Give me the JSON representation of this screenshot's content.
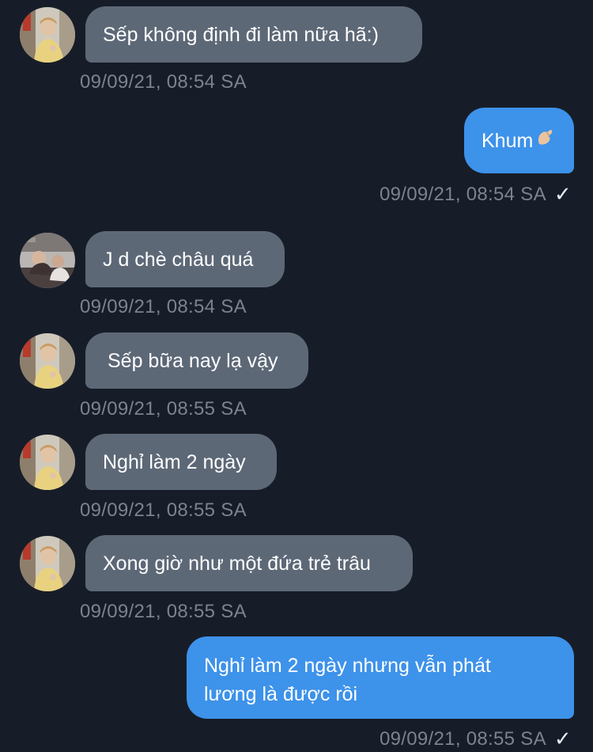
{
  "messages": [
    {
      "direction": "in",
      "sender_avatar": "avatar-boss",
      "text": "Sếp không định đi làm nữa hã:)",
      "time": "09/09/21, 08:54 SA"
    },
    {
      "direction": "out",
      "text": "Khum",
      "emoji": "pinching-hand-emoji",
      "time": "09/09/21, 08:54 SA",
      "status_icon": "read-check-icon",
      "status_glyph": "✓"
    },
    {
      "direction": "in",
      "sender_avatar": "avatar-friend",
      "text": "J d chè châu quá",
      "time": "09/09/21, 08:54 SA"
    },
    {
      "direction": "in",
      "sender_avatar": "avatar-boss",
      "text": "Sếp bữa nay lạ vậy",
      "time": "09/09/21, 08:55 SA"
    },
    {
      "direction": "in",
      "sender_avatar": "avatar-boss",
      "text": "Nghỉ làm 2 ngày",
      "time": "09/09/21, 08:55 SA"
    },
    {
      "direction": "in",
      "sender_avatar": "avatar-boss",
      "text": "Xong giờ như một đứa trẻ trâu",
      "time": "09/09/21, 08:55 SA"
    },
    {
      "direction": "out",
      "text_line1": "Nghỉ làm 2 ngày nhưng vẫn phát",
      "text_line2": "lương là được rồi",
      "time": "09/09/21, 08:55 SA",
      "status_icon": "read-check-icon",
      "status_glyph": "✓"
    }
  ],
  "colors": {
    "background": "#171d28",
    "incoming_bubble": "#5d6877",
    "outgoing_bubble": "#3d92ea",
    "timestamp": "#7b838f"
  }
}
